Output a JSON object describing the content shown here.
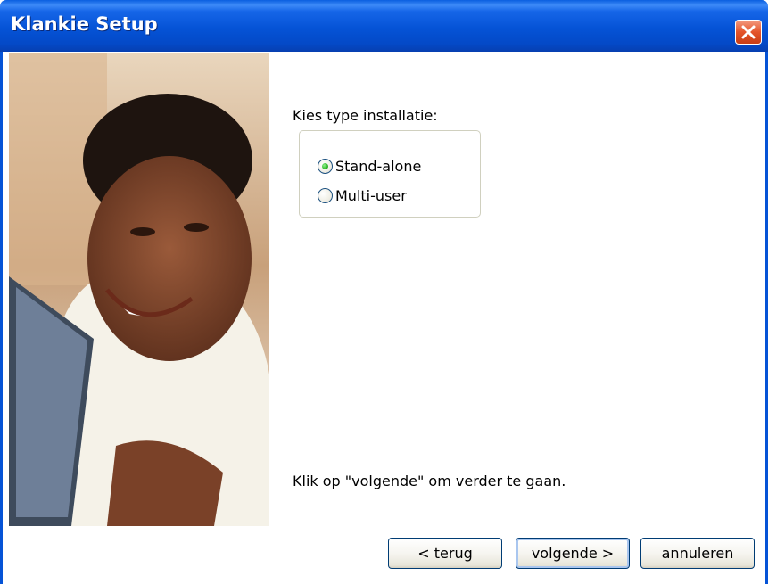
{
  "window": {
    "title": "Klankie Setup",
    "close_icon": "close-icon"
  },
  "content": {
    "prompt": "Kies type installatie:",
    "options": [
      {
        "label": "Stand-alone",
        "selected": true
      },
      {
        "label": "Multi-user",
        "selected": false
      }
    ],
    "hint": "Klik op \"volgende\" om verder te gaan."
  },
  "buttons": {
    "back": "< terug",
    "next": "volgende >",
    "cancel": "annuleren"
  },
  "colors": {
    "titlebar": "#0553d6",
    "close": "#e4542a",
    "radio_dot": "#31b82a"
  }
}
